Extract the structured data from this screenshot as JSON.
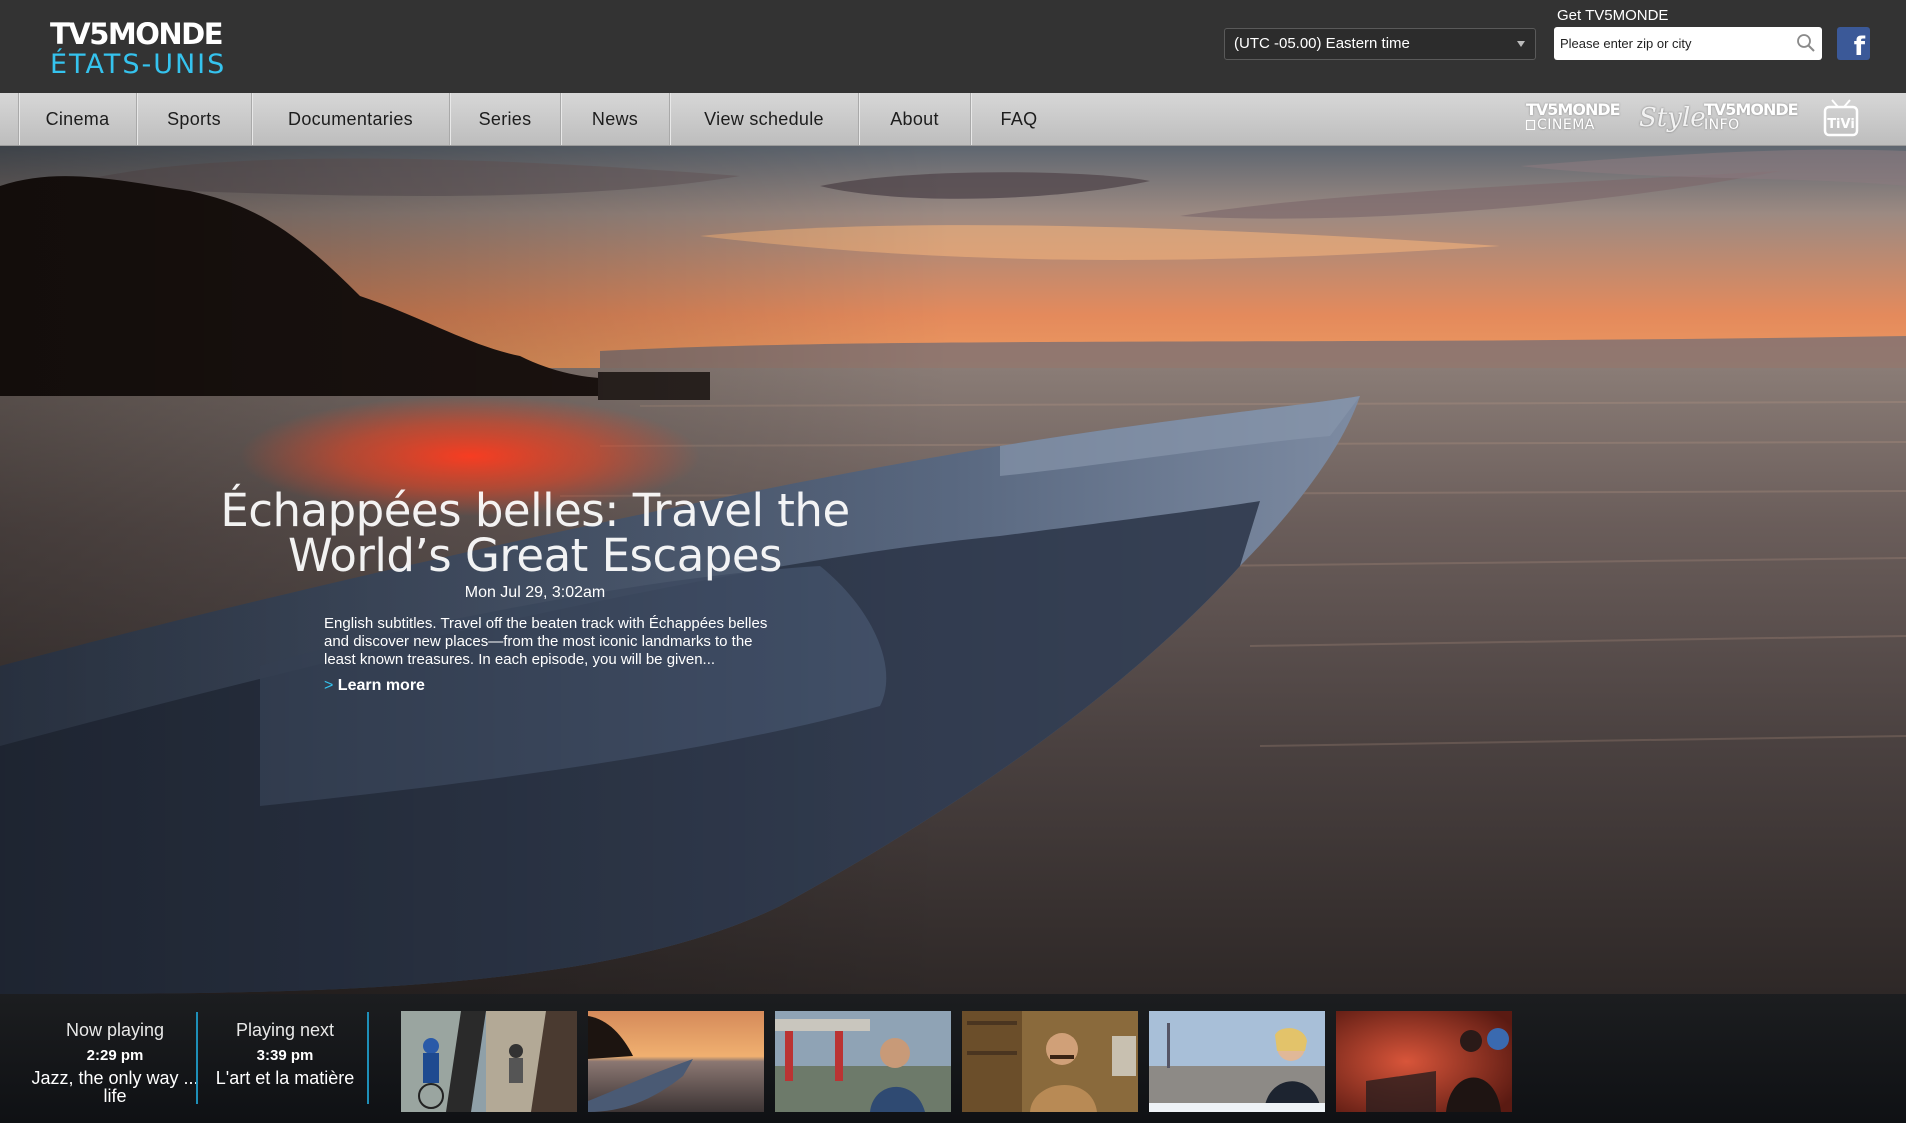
{
  "header": {
    "logo_line1": "TV5MONDE",
    "logo_line2": "ÉTATS-UNIS",
    "timezone": "(UTC -05.00) Eastern time",
    "get_label": "Get TV5MONDE",
    "zip_placeholder": "Please enter zip or city",
    "facebook_glyph": "f"
  },
  "nav": {
    "items": [
      {
        "label": "Cinema"
      },
      {
        "label": "Sports"
      },
      {
        "label": "Documentaries"
      },
      {
        "label": "Series"
      },
      {
        "label": "News"
      },
      {
        "label": "View schedule"
      },
      {
        "label": "About"
      },
      {
        "label": "FAQ"
      }
    ],
    "channels": {
      "cinema_top": "TV5MONDE",
      "cinema_bottom": "CINEMA",
      "style": "Style",
      "info_top": "TV5MONDE",
      "info_bottom": "INFO",
      "tivi": "TiVi"
    }
  },
  "hero": {
    "title_line1": "Échappées belles: Travel the",
    "title_line2": "World’s Great Escapes",
    "datetime": "Mon Jul 29, 3:02am",
    "description": "English subtitles. Travel off the beaten track with Échappées belles and discover new places—from the most iconic landmarks to the least known treasures. In each episode, you will be given...",
    "learn_more_arrow": ">",
    "learn_more": "Learn more"
  },
  "schedule": {
    "now": {
      "label": "Now playing",
      "time": "2:29 pm",
      "title": "Jazz, the only way ... life"
    },
    "next": {
      "label": "Playing next",
      "time": "3:39 pm",
      "title": "L'art et la matière"
    }
  },
  "colors": {
    "accent": "#35c3ee",
    "header_bg": "#333333",
    "nav_bg": "#cfcfcf",
    "facebook": "#3b5998",
    "divider": "#1e8fb8"
  },
  "icons": [
    "search-icon",
    "facebook-icon",
    "dropdown-caret-icon"
  ]
}
